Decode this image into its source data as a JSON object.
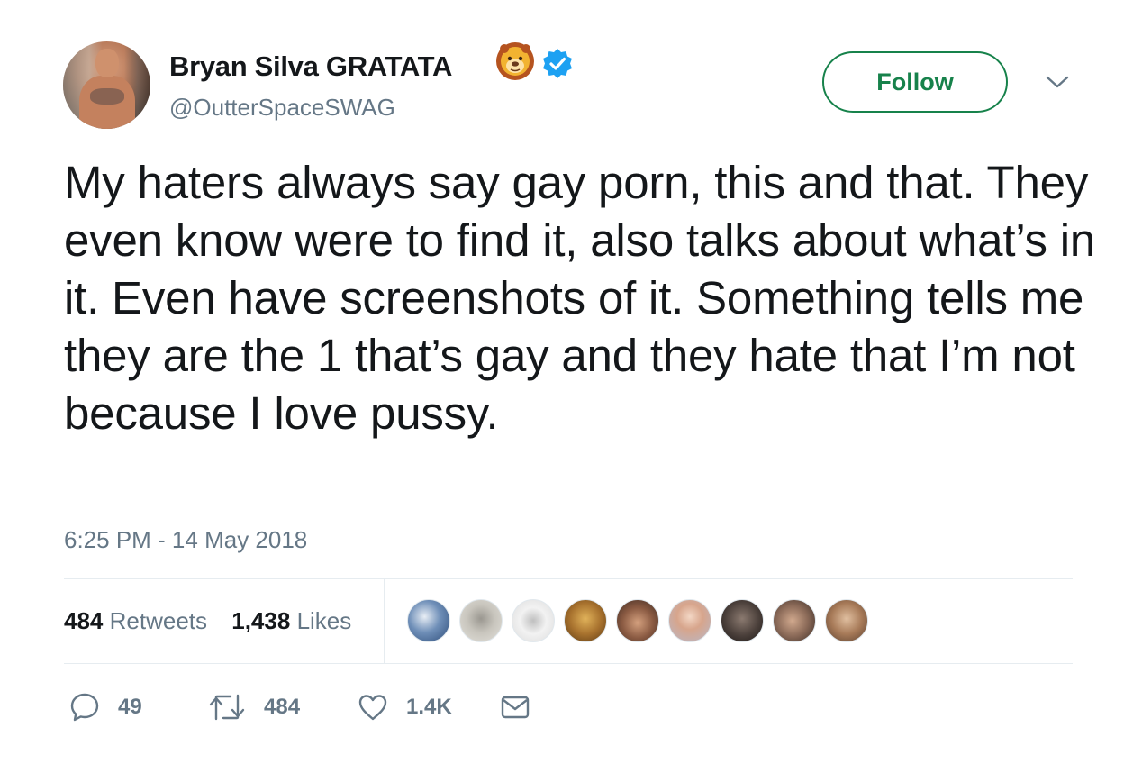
{
  "author": {
    "display_name": "Bryan Silva GRATATA",
    "emoji_icon": "lion-face-icon",
    "verified_icon": "verified-badge-icon",
    "handle": "@OutterSpaceSWAG"
  },
  "follow_label": "Follow",
  "tweet": {
    "text": "My haters always say gay porn, this and that. They even know were to find it, also talks about what’s in it. Even have screenshots of it. Something tells me they are the 1 that’s gay and they hate that I’m not because I love pussy.",
    "timestamp": "6:25 PM - 14 May 2018"
  },
  "stats": {
    "retweets_count": "484",
    "retweets_label": "Retweets",
    "likes_count": "1,438",
    "likes_label": "Likes"
  },
  "likers": [
    "liker-avatar-1",
    "liker-avatar-2",
    "liker-avatar-3",
    "liker-avatar-4",
    "liker-avatar-5",
    "liker-avatar-6",
    "liker-avatar-7",
    "liker-avatar-8",
    "liker-avatar-9"
  ],
  "actions": {
    "reply_count": "49",
    "retweet_count": "484",
    "like_count": "1.4K"
  },
  "colors": {
    "text": "#14171a",
    "secondary": "#657786",
    "follow_green": "#17824b",
    "verified_blue": "#1da1f2",
    "divider": "#e6ecf0"
  }
}
